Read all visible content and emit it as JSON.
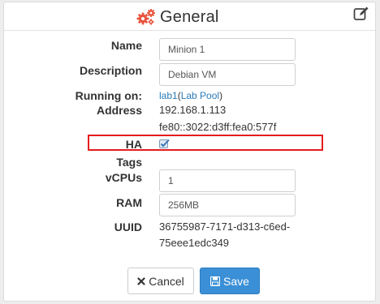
{
  "header": {
    "title": "General"
  },
  "fields": {
    "name_label": "Name",
    "name_value": "Minion 1",
    "description_label": "Description",
    "description_value": "Debian VM",
    "running_label": "Running on:",
    "running_host": "lab1",
    "running_pool_open": "(",
    "running_pool": "Lab Pool",
    "running_pool_close": ")",
    "address_label": "Address",
    "address_ipv4": "192.168.1.113",
    "address_ipv6": "fe80::3022:d3ff:fea0:577f",
    "ha_label": "HA",
    "ha_checked": true,
    "tags_label": "Tags",
    "vcpus_label": "vCPUs",
    "vcpus_value": "1",
    "ram_label": "RAM",
    "ram_value": "256MB",
    "uuid_label": "UUID",
    "uuid_line1": "36755987-7171-d313-c6ed-",
    "uuid_line2": "75eee1edc349"
  },
  "buttons": {
    "cancel_label": "Cancel",
    "save_label": "Save"
  },
  "colors": {
    "accent": "#e8543e",
    "link": "#2a7ab8",
    "save_bg": "#3a8fd6",
    "highlight": "#e41c1c"
  },
  "icons": {
    "title": "gears-icon",
    "edit": "edit-icon",
    "cancel": "close-icon",
    "save": "floppy-icon"
  }
}
